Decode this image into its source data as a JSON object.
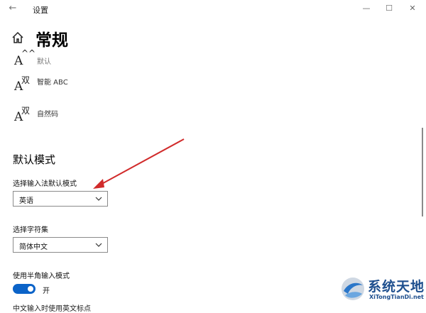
{
  "window": {
    "title": "设置",
    "back_icon": "←",
    "minimize_icon": "—",
    "maximize_icon": "☐",
    "close_icon": "✕"
  },
  "page": {
    "title": "常规",
    "home_icon": "home-icon"
  },
  "ime_list": [
    {
      "glyph_latin": "A",
      "glyph_cjk": "^^",
      "label": "默认"
    },
    {
      "glyph_latin": "A",
      "glyph_cjk": "双",
      "label": "智能 ABC"
    },
    {
      "glyph_latin": "A",
      "glyph_cjk": "双",
      "label": "自然码"
    }
  ],
  "default_mode": {
    "heading": "默认模式",
    "input_mode_label": "选择输入法默认模式",
    "input_mode_value": "英语",
    "charset_label": "选择字符集",
    "charset_value": "简体中文",
    "halfwidth_label": "使用半角输入模式",
    "halfwidth_toggle_text": "开",
    "halfwidth_on": true,
    "cut_off_text": "中文输入时使用英文标点"
  },
  "watermark": {
    "main": "系统天地",
    "sub": "XiTongTianDi.net"
  },
  "colors": {
    "accent": "#0b63c8",
    "arrow": "#d12b2b",
    "watermark": "#1e4f8e"
  }
}
